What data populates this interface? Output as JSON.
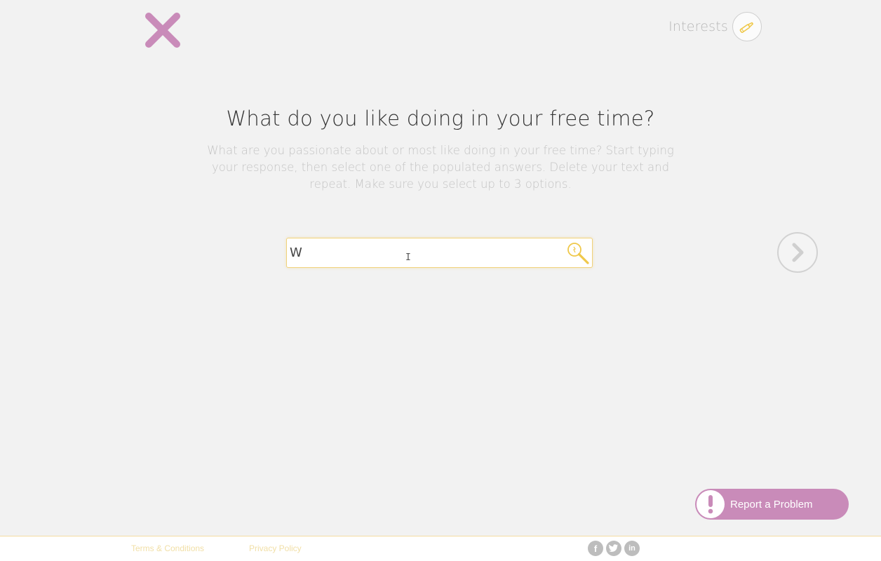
{
  "header": {
    "section_label": "Interests"
  },
  "main": {
    "question": "What do you like doing in your free time?",
    "instructions": "What are you passionate about or most like doing in your free time? Start typing your response, then select one of the populated answers. Delete your text and repeat. Make sure you select up to 3 options.",
    "search": {
      "value": "W"
    }
  },
  "report": {
    "label": "Report a Problem"
  },
  "footer": {
    "terms_label": "Terms & Conditions",
    "privacy_label": "Privacy Policy",
    "social": [
      "facebook-icon",
      "twitter-icon",
      "linkedin-icon"
    ]
  },
  "colors": {
    "accent_pink": "#c98bb9",
    "accent_yellow": "#f0d27a",
    "background": "#f2f2f2"
  }
}
